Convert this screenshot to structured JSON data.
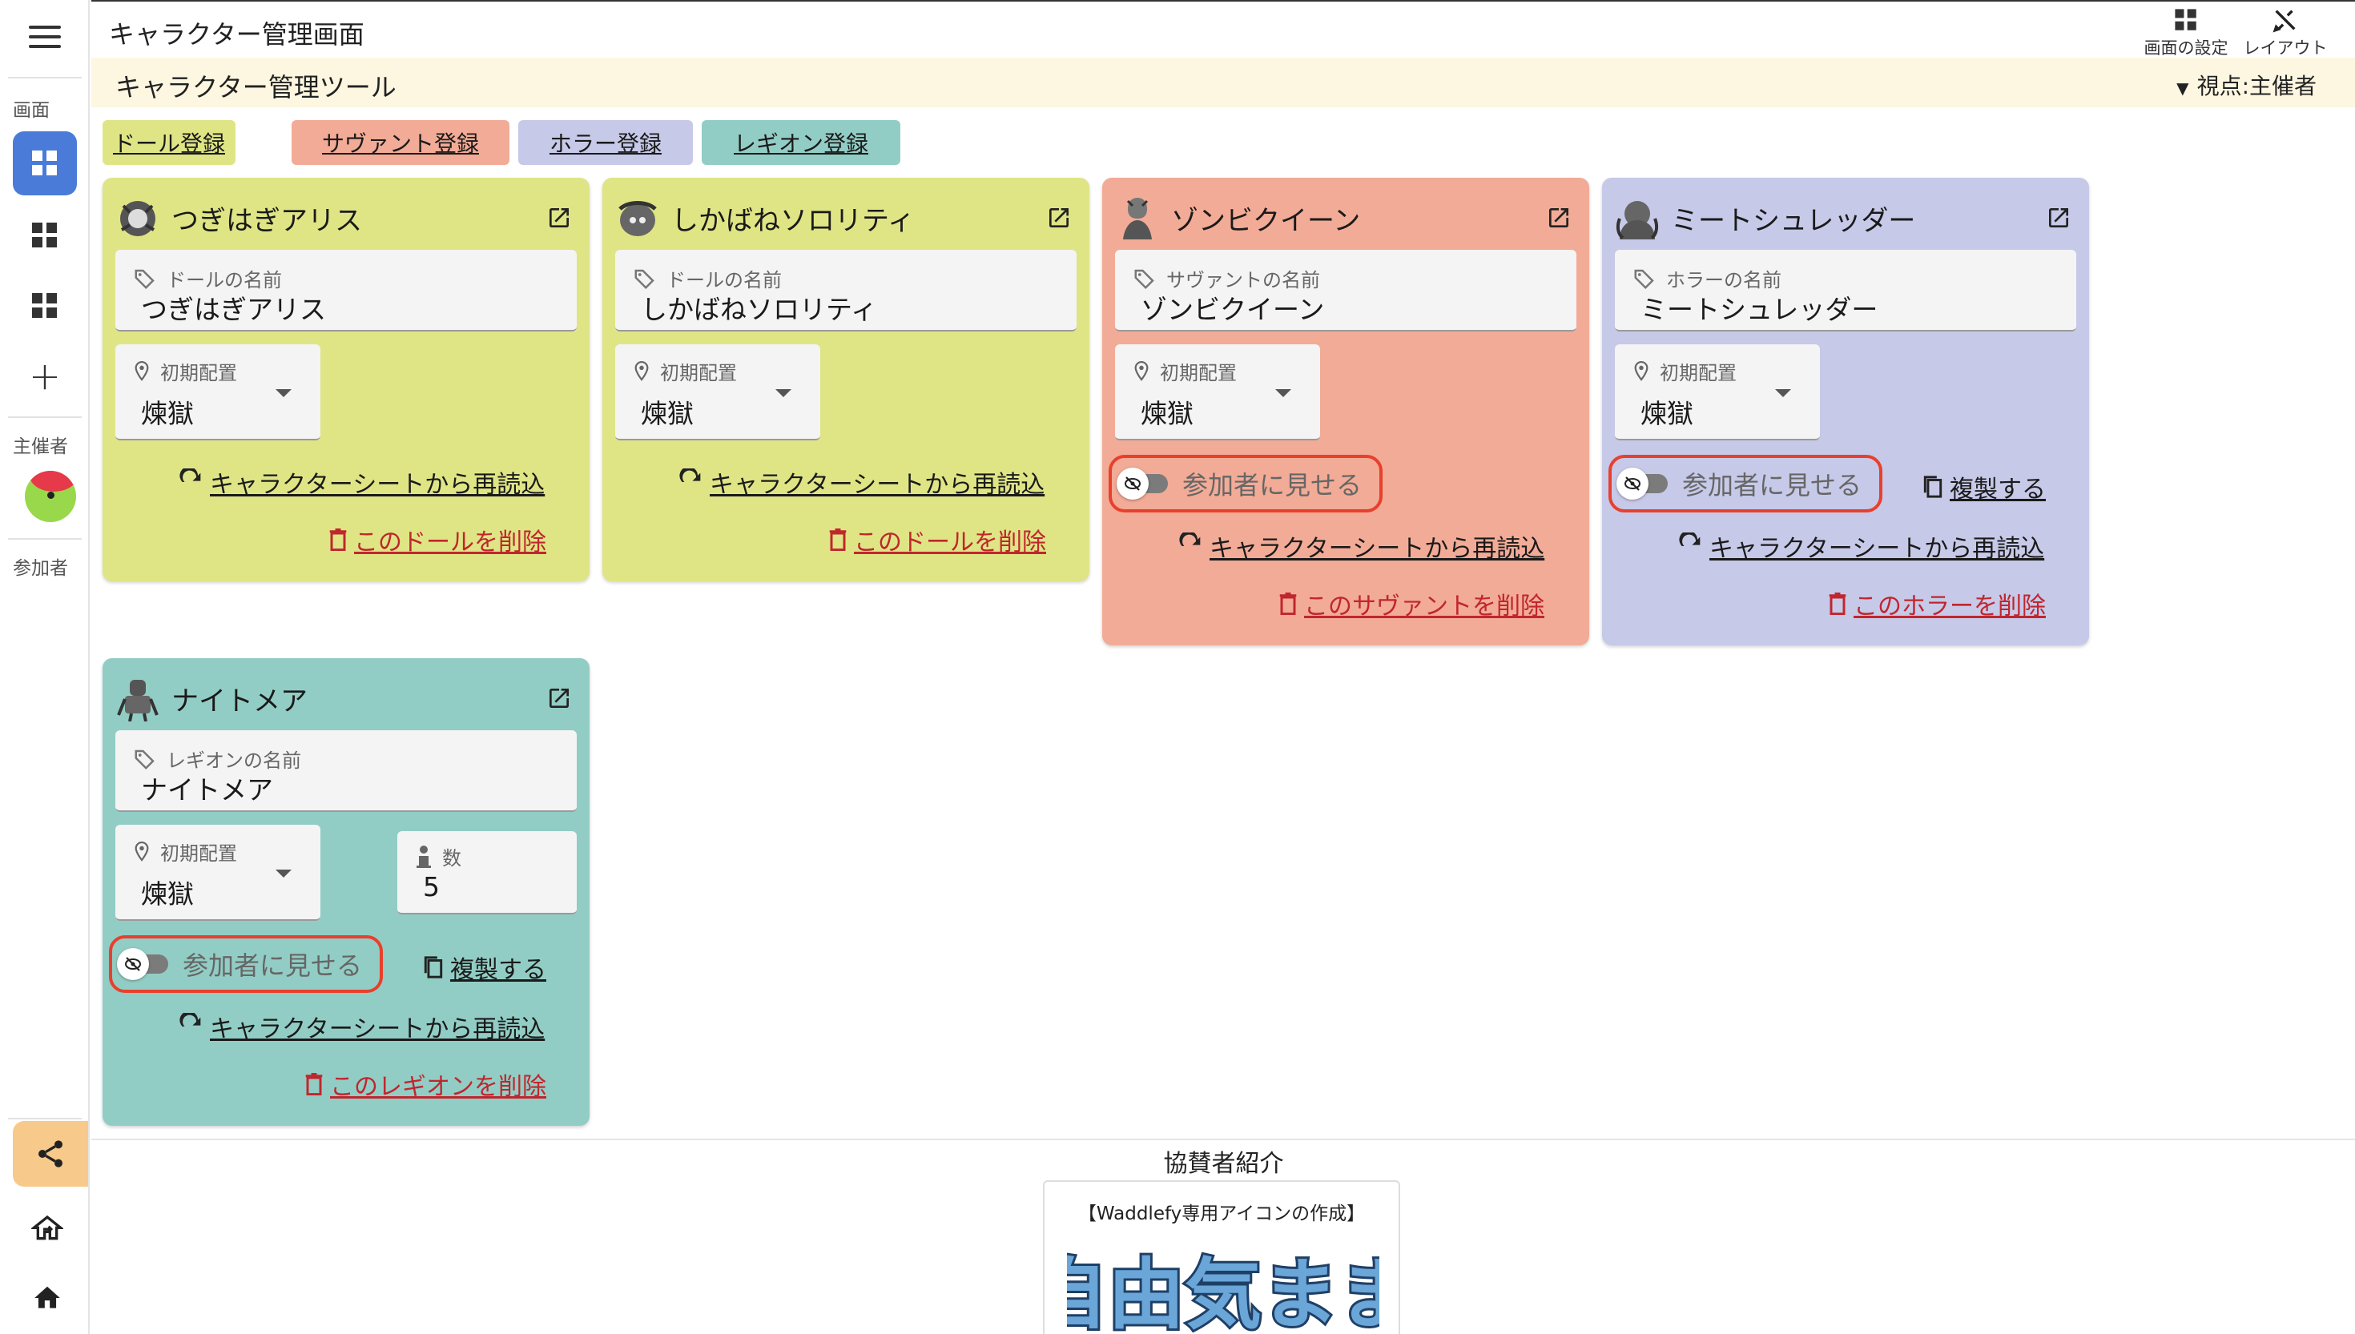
{
  "rail": {
    "section_screen": "画面",
    "section_host": "主催者",
    "section_participant": "参加者"
  },
  "topbar": {
    "title": "キャラクター管理画面",
    "screen_settings": "画面の設定",
    "layout": "レイアウト"
  },
  "toolbar": {
    "title": "キャラクター管理ツール",
    "viewpoint": "視点:主催者"
  },
  "register_buttons": [
    {
      "label": "ドール登録",
      "color": "#dfe585"
    },
    {
      "label": "サヴァント登録",
      "color": "#f2ab96"
    },
    {
      "label": "ホラー登録",
      "color": "#c7c9e8"
    },
    {
      "label": "レギオン登録",
      "color": "#92cdc5"
    }
  ],
  "cards": [
    {
      "name": "つぎはぎアリス",
      "color": "#dfe585",
      "name_label": "ドールの名前",
      "name_value": "つぎはぎアリス",
      "position_label": "初期配置",
      "position_value": "煉獄",
      "reload": "キャラクターシートから再読込",
      "delete": "このドールを削除"
    },
    {
      "name": "しかばねソロリティ",
      "color": "#dfe585",
      "name_label": "ドールの名前",
      "name_value": "しかばねソロリティ",
      "position_label": "初期配置",
      "position_value": "煉獄",
      "reload": "キャラクターシートから再読込",
      "delete": "このドールを削除"
    },
    {
      "name": "ゾンビクイーン",
      "color": "#f2ab96",
      "name_label": "サヴァントの名前",
      "name_value": "ゾンビクイーン",
      "position_label": "初期配置",
      "position_value": "煉獄",
      "visibility": "参加者に見せる",
      "reload": "キャラクターシートから再読込",
      "delete": "このサヴァントを削除"
    },
    {
      "name": "ミートシュレッダー",
      "color": "#c7c9e8",
      "name_label": "ホラーの名前",
      "name_value": "ミートシュレッダー",
      "position_label": "初期配置",
      "position_value": "煉獄",
      "visibility": "参加者に見せる",
      "duplicate": "複製する",
      "reload": "キャラクターシートから再読込",
      "delete": "このホラーを削除"
    },
    {
      "name": "ナイトメア",
      "color": "#92cdc5",
      "name_label": "レギオンの名前",
      "name_value": "ナイトメア",
      "position_label": "初期配置",
      "position_value": "煉獄",
      "count_label": "数",
      "count_value": "5",
      "visibility": "参加者に見せる",
      "duplicate": "複製する",
      "reload": "キャラクターシートから再読込",
      "delete": "このレギオンを削除"
    }
  ],
  "footer": {
    "sponsor_title": "協賛者紹介",
    "sponsor_caption": "【Waddlefy専用アイコンの作成】",
    "sponsor_logo_text": "自由気まま"
  },
  "icons": {
    "menu": "hamburger-icon",
    "dashboard": "dashboard-icon",
    "add": "plus-icon",
    "share": "share-icon",
    "exit": "exit-home-icon",
    "home": "home-icon",
    "open": "open-in-new-icon",
    "tag": "tag-icon",
    "pin": "location-pin-icon",
    "person": "person-icon",
    "reload": "refresh-icon",
    "delete": "trash-icon",
    "copy": "copy-icon",
    "hidden": "eye-off-icon"
  },
  "colors": {
    "accent": "#4a7bd8",
    "danger": "#c0262d",
    "highlight_border": "#e8402c",
    "toolbar_bg": "#fdf7e1"
  }
}
